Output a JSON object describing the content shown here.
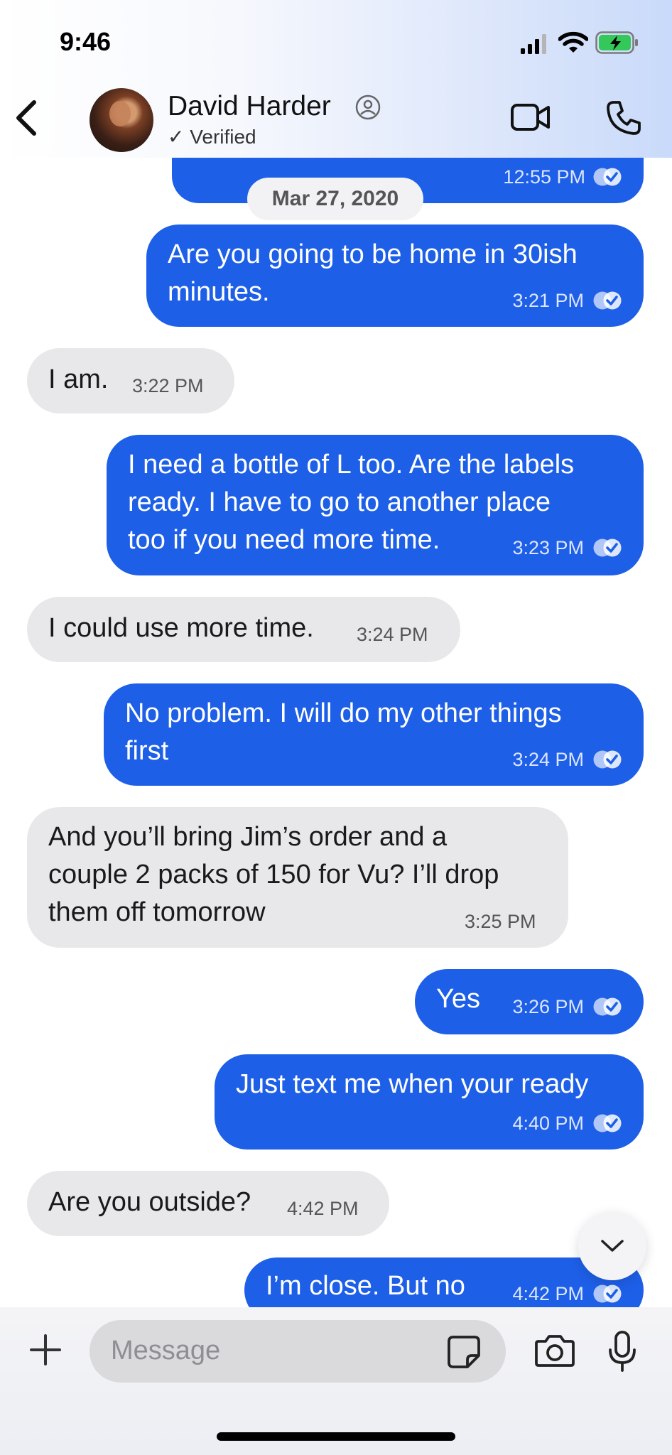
{
  "status_bar": {
    "time": "9:46"
  },
  "header": {
    "contact_name": "David Harder",
    "verified_label": "✓ Verified"
  },
  "chat": {
    "date_divider": "Mar 27, 2020",
    "messages": [
      {
        "dir": "out",
        "text": "",
        "time": "12:55 PM"
      },
      {
        "dir": "out",
        "text": "Are you going to be home in 30ish\nminutes.",
        "time": "3:21 PM"
      },
      {
        "dir": "in",
        "text": "I am.",
        "time": "3:22 PM"
      },
      {
        "dir": "out",
        "text": "I need a bottle of L too. Are the labels\nready. I have to go to another place\ntoo if you need more time.",
        "time": "3:23 PM"
      },
      {
        "dir": "in",
        "text": "I could use more time.",
        "time": "3:24 PM"
      },
      {
        "dir": "out",
        "text": "No problem.   I will do my other things\nfirst",
        "time": "3:24 PM"
      },
      {
        "dir": "in",
        "text": "And you’ll bring Jim’s order and a\ncouple 2 packs of 150 for Vu? I’ll drop\nthem off tomorrow",
        "time": "3:25 PM"
      },
      {
        "dir": "out",
        "text": "Yes",
        "time": "3:26 PM"
      },
      {
        "dir": "out",
        "text": "Just text me when your ready",
        "time": "4:40 PM"
      },
      {
        "dir": "in",
        "text": "Are you outside?",
        "time": "4:42 PM"
      },
      {
        "dir": "out",
        "text": "I’m close. But no",
        "time": "4:42 PM"
      }
    ]
  },
  "composer": {
    "placeholder": "Message"
  },
  "colors": {
    "outgoing_bubble": "#1e5fe8",
    "incoming_bubble": "#e8e8ea",
    "battery": "#34c759"
  },
  "icons": [
    "back-chevron-icon",
    "person-circle-icon",
    "video-camera-icon",
    "phone-icon",
    "read-check-icon",
    "chevron-down-icon",
    "plus-icon",
    "sticker-icon",
    "camera-icon",
    "microphone-icon",
    "cellular-signal-icon",
    "wifi-icon",
    "battery-charging-icon"
  ]
}
